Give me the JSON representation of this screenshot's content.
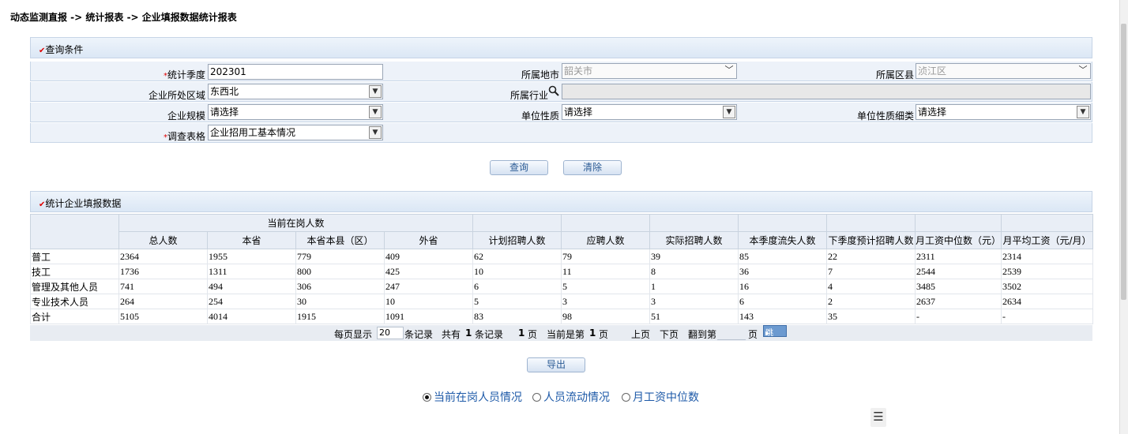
{
  "breadcrumb": "动态监测直报 -> 统计报表 -> 企业填报数据统计报表",
  "query": {
    "section_title": "查询条件",
    "fields": {
      "period": {
        "label": "统计季度",
        "value": "202301"
      },
      "city": {
        "label": "所属地市",
        "value": "韶关市"
      },
      "county": {
        "label": "所属区县",
        "value": "浈江区"
      },
      "region": {
        "label": "企业所处区域",
        "value": "东西北"
      },
      "industry": {
        "label": "所属行业",
        "value": ""
      },
      "scale": {
        "label": "企业规模",
        "value": "请选择"
      },
      "nature": {
        "label": "单位性质",
        "value": "请选择"
      },
      "nature_detail": {
        "label": "单位性质细类",
        "value": "请选择"
      },
      "survey": {
        "label": "调查表格",
        "value": "企业招用工基本情况"
      }
    },
    "buttons": {
      "query": "查询",
      "clear": "清除"
    }
  },
  "stats": {
    "section_title": "统计企业填报数据",
    "group_header": "当前在岗人数",
    "columns": [
      "总人数",
      "本省",
      "本省本县（区）",
      "外省",
      "计划招聘人数",
      "应聘人数",
      "实际招聘人数",
      "本季度流失人数",
      "下季度预计招聘人数",
      "月工资中位数（元）",
      "月平均工资（元/月）"
    ],
    "rows": [
      {
        "label": "普工",
        "values": [
          "2364",
          "1955",
          "779",
          "409",
          "62",
          "79",
          "39",
          "85",
          "22",
          "2311",
          "2314"
        ]
      },
      {
        "label": "技工",
        "values": [
          "1736",
          "1311",
          "800",
          "425",
          "10",
          "11",
          "8",
          "36",
          "7",
          "2544",
          "2539"
        ]
      },
      {
        "label": "管理及其他人员",
        "values": [
          "741",
          "494",
          "306",
          "247",
          "6",
          "5",
          "1",
          "16",
          "4",
          "3485",
          "3502"
        ]
      },
      {
        "label": "专业技术人员",
        "values": [
          "264",
          "254",
          "30",
          "10",
          "5",
          "3",
          "3",
          "6",
          "2",
          "2637",
          "2634"
        ]
      },
      {
        "label": "合计",
        "values": [
          "5105",
          "4014",
          "1915",
          "1091",
          "83",
          "98",
          "51",
          "143",
          "35",
          "-",
          "-"
        ]
      }
    ]
  },
  "pager": {
    "per_page_label": "每页显示",
    "per_page": "20",
    "records_label": "条记录",
    "total_prefix": "共有",
    "total": "1",
    "total_suffix": "条记录",
    "pages": "1",
    "page_unit": "页",
    "current_prefix": "当前是第",
    "current": "1",
    "prev": "上页",
    "next": "下页",
    "goto_prefix": "翻到第",
    "goto_suffix": "页",
    "go": "跳"
  },
  "export_label": "导出",
  "views": [
    {
      "label": "当前在岗人员情况",
      "selected": true
    },
    {
      "label": "人员流动情况",
      "selected": false
    },
    {
      "label": "月工资中位数",
      "selected": false
    }
  ],
  "icons": {
    "search": "search-icon",
    "dropdown": "chevron-down-icon",
    "menu": "menu-icon"
  }
}
